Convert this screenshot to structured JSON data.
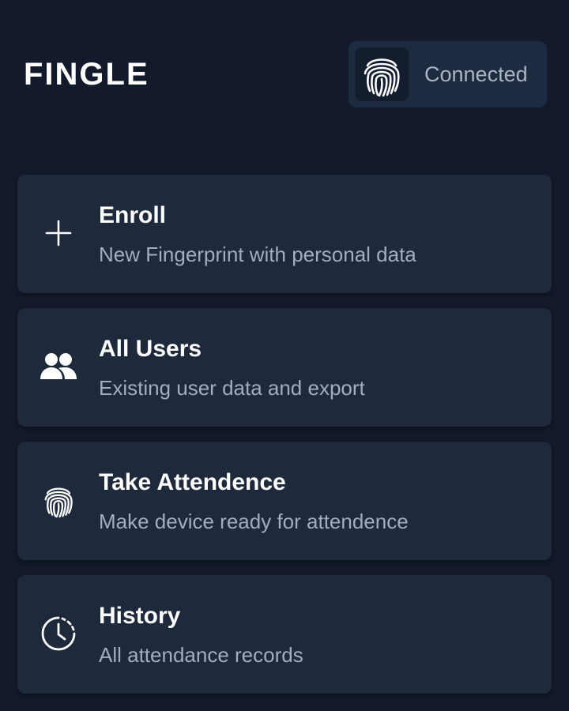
{
  "header": {
    "title": "FINGLE",
    "status": {
      "label": "Connected",
      "icon": "fingerprint-icon"
    }
  },
  "menu": {
    "items": [
      {
        "title": "Enroll",
        "subtitle": "New Fingerprint with personal data",
        "icon": "plus-icon"
      },
      {
        "title": "All Users",
        "subtitle": "Existing user data and export",
        "icon": "users-icon"
      },
      {
        "title": "Take Attendence",
        "subtitle": "Make device ready for attendence",
        "icon": "fingerprint-icon"
      },
      {
        "title": "History",
        "subtitle": "All attendance records",
        "icon": "history-clock-icon"
      }
    ]
  },
  "colors": {
    "background": "#121a2b",
    "card": "#1e293c",
    "title": "#ffffff",
    "subtitle": "#a3adbd"
  }
}
